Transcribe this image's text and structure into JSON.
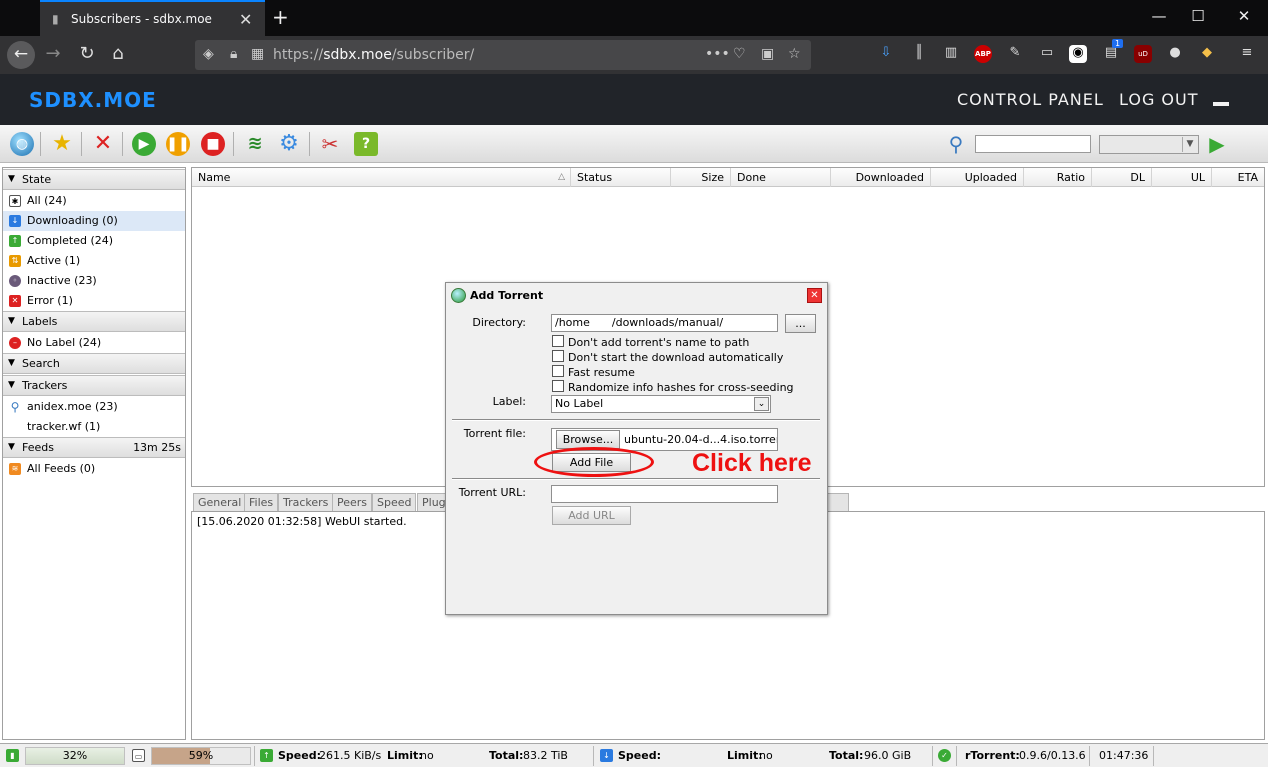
{
  "browser": {
    "tab_title": "Subscribers - sdbx.moe",
    "url_prefix": "https://",
    "url_domain": "sdbx.moe",
    "url_path": "/subscriber/",
    "badge_count": "1",
    "ext_abp": "ABP",
    "ext_ublock": "uD"
  },
  "site": {
    "logo": "SDBX.MOE",
    "nav_control_panel": "CONTROL PANEL",
    "nav_logout": "LOG OUT"
  },
  "sidebar": {
    "state_header": "State",
    "state_items": [
      {
        "label": "All (24)",
        "icon": "all-icon"
      },
      {
        "label": "Downloading (0)",
        "icon": "downloading-icon"
      },
      {
        "label": "Completed (24)",
        "icon": "completed-icon"
      },
      {
        "label": "Active (1)",
        "icon": "active-icon"
      },
      {
        "label": "Inactive (23)",
        "icon": "inactive-icon"
      },
      {
        "label": "Error (1)",
        "icon": "error-icon"
      }
    ],
    "labels_header": "Labels",
    "labels_items": [
      {
        "label": "No Label (24)"
      }
    ],
    "search_header": "Search",
    "trackers_header": "Trackers",
    "trackers_items": [
      {
        "label": "anidex.moe (23)"
      },
      {
        "label": "tracker.wf (1)"
      }
    ],
    "feeds_header": "Feeds",
    "feeds_time": "13m 25s",
    "feeds_items": [
      {
        "label": "All Feeds (0)"
      }
    ]
  },
  "table": {
    "columns": [
      "Name",
      "Status",
      "Size",
      "Done",
      "Downloaded",
      "Uploaded",
      "Ratio",
      "DL",
      "UL",
      "ETA"
    ]
  },
  "bottom_tabs": [
    "General",
    "Files",
    "Trackers",
    "Peers",
    "Speed",
    "Plug"
  ],
  "log": {
    "line": "[15.06.2020 01:32:58] WebUI started."
  },
  "dialog": {
    "title": "Add Torrent",
    "directory_label": "Directory:",
    "directory_part1": "/home",
    "directory_part2": "/downloads/manual/",
    "browse_dir_button": "...",
    "checkboxes": [
      "Don't add torrent's name to path",
      "Don't start the download automatically",
      "Fast resume",
      "Randomize info hashes for cross-seeding"
    ],
    "label_label": "Label:",
    "label_value": "No Label",
    "torrent_file_label": "Torrent file:",
    "browse_button": "Browse...",
    "file_name": "ubuntu-20.04-d...4.iso.torrent",
    "add_file_button": "Add File",
    "torrent_url_label": "Torrent URL:",
    "torrent_url_value": "",
    "add_url_button": "Add URL"
  },
  "annotation": {
    "text": "Click here",
    "color": "#e11111"
  },
  "statusbar": {
    "disk_percent": "32%",
    "mem_percent": "59%",
    "ul_speed_label": "Speed:",
    "ul_speed": "261.5 KiB/s",
    "ul_limit_label": "Limit:",
    "ul_limit": "no",
    "ul_total_label": "Total:",
    "ul_total": "83.2 TiB",
    "dl_speed_label": "Speed:",
    "dl_limit_label": "Limit:",
    "dl_limit": "no",
    "dl_total_label": "Total:",
    "dl_total": "96.0 GiB",
    "client_label": "rTorrent:",
    "client_version": "0.9.6/0.13.6",
    "clock": "01:47:36"
  },
  "colors": {
    "accent_blue": "#0a84ff",
    "logo_blue": "#1e90ff",
    "header_bg": "#212429"
  }
}
